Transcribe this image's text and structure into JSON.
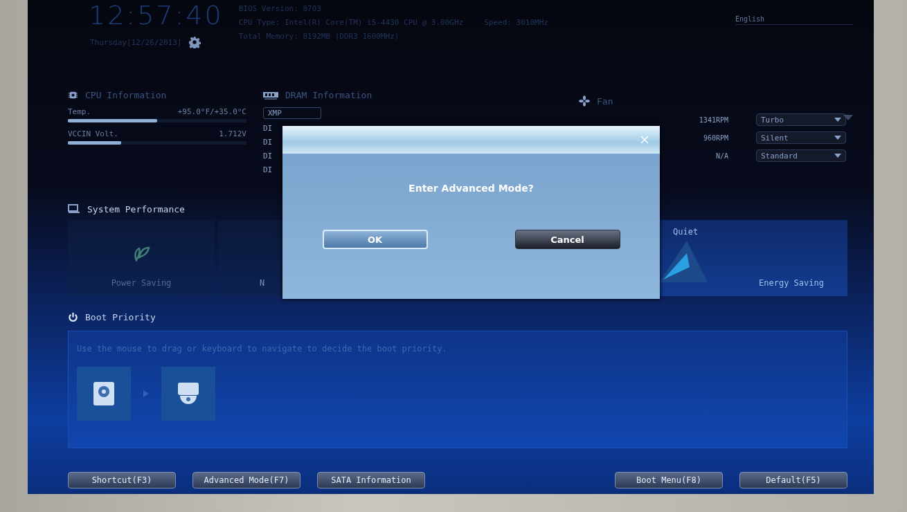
{
  "header": {
    "time": "12:57:40",
    "date": "Thursday[12/26/2013]",
    "info_lines": [
      "BIOS Version: 0703",
      "CPU Type: Intel(R) Core(TM) i5-4430 CPU @ 3.00GHz",
      "Total Memory: 8192MB (DDR3 1600MHz)"
    ],
    "speed": "Speed: 3010MHz",
    "language": "English"
  },
  "cpu": {
    "title": "CPU Information",
    "metrics": [
      {
        "label": "Temp.",
        "reading": "+95.0°F/+35.0°C",
        "level": 0.5
      },
      {
        "label": "VCCIN Volt.",
        "reading": "1.712V",
        "level": 0.3
      }
    ]
  },
  "dram": {
    "title": "DRAM Information",
    "xmp": "XMP",
    "slots": [
      "DI",
      "DI",
      "DI",
      "DI"
    ]
  },
  "fan": {
    "title": "Fan",
    "rows": [
      {
        "reading": "1341RPM",
        "mode": "Turbo"
      },
      {
        "reading": "960RPM",
        "mode": "Silent"
      },
      {
        "reading": "N/A",
        "mode": "Standard"
      }
    ]
  },
  "performance": {
    "title": "System Performance",
    "tiles": [
      {
        "kind": "leaf",
        "label": "Power Saving"
      },
      {
        "kind": "plain",
        "label": "N"
      },
      {
        "kind": "graph",
        "top": "Quiet",
        "label": "Energy Saving"
      }
    ]
  },
  "boot": {
    "title": "Boot Priority",
    "hint": "Use the mouse to drag or keyboard to navigate to decide the boot priority.",
    "devices": [
      {
        "kind": "disk"
      },
      {
        "kind": "optical"
      }
    ]
  },
  "buttons": {
    "left": [
      "Shortcut(F3)",
      "Advanced Mode(F7)",
      "SATA Information"
    ],
    "right": [
      "Boot Menu(F8)",
      "Default(F5)"
    ]
  },
  "dialog": {
    "message": "Enter Advanced Mode?",
    "buttons": [
      {
        "label": "OK",
        "kind": "primary"
      },
      {
        "label": "Cancel",
        "kind": "secondary"
      }
    ]
  }
}
